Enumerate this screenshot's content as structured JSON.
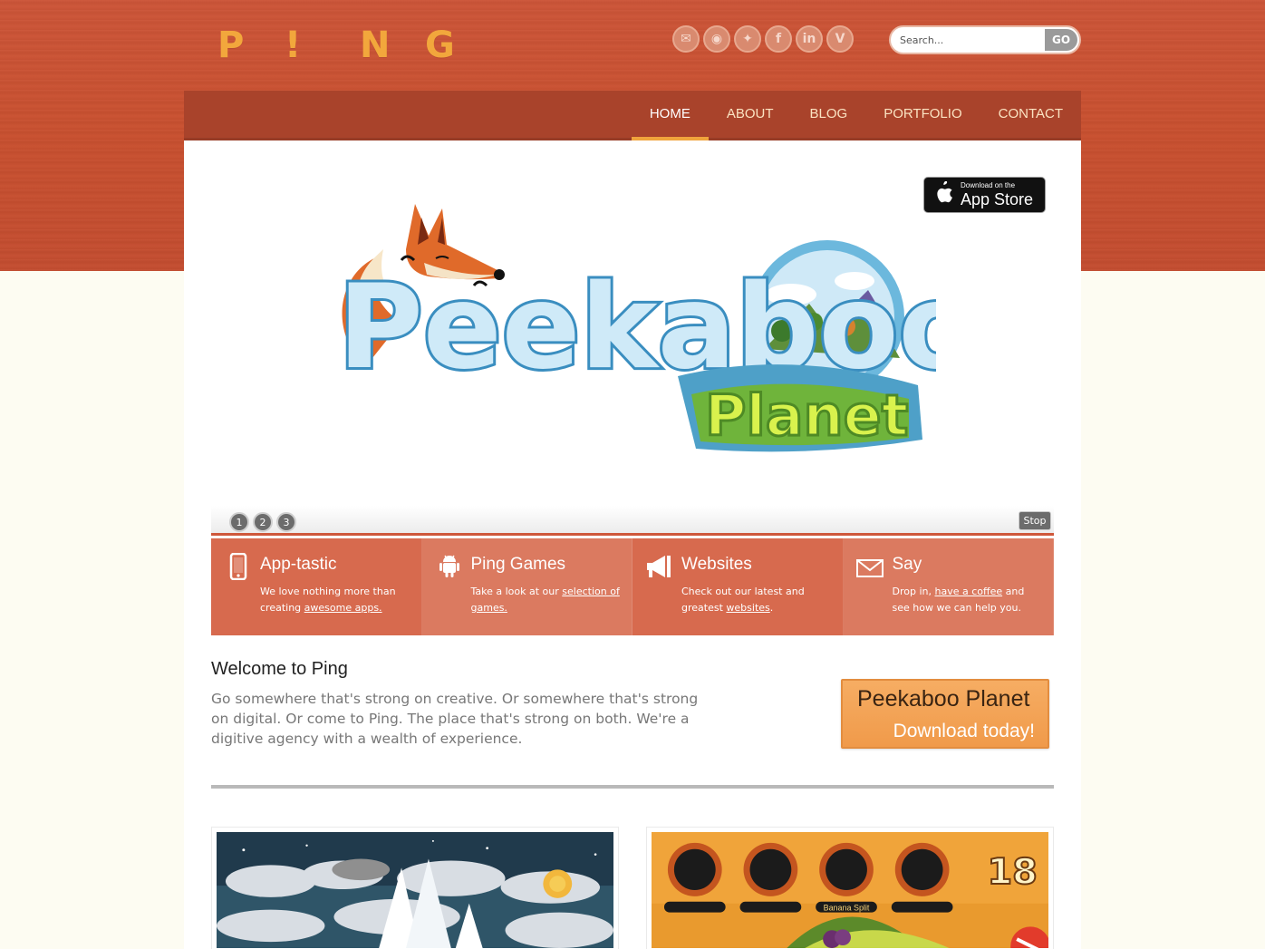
{
  "logo": {
    "letters": [
      "P",
      "!",
      "N",
      "G"
    ]
  },
  "social": [
    {
      "icon": "mail-icon",
      "glyph": "✉"
    },
    {
      "icon": "rss-icon",
      "glyph": "◉"
    },
    {
      "icon": "twitter-icon",
      "glyph": "✦"
    },
    {
      "icon": "facebook-icon",
      "glyph": "f"
    },
    {
      "icon": "linkedin-icon",
      "glyph": "in"
    },
    {
      "icon": "vimeo-icon",
      "glyph": "V"
    }
  ],
  "search": {
    "placeholder": "Search...",
    "button": "GO"
  },
  "nav": {
    "items": [
      {
        "label": "HOME",
        "active": true
      },
      {
        "label": "ABOUT"
      },
      {
        "label": "BLOG"
      },
      {
        "label": "PORTFOLIO"
      },
      {
        "label": "CONTACT"
      }
    ]
  },
  "appstore": {
    "small": "Download on the",
    "big": "App Store"
  },
  "hero": {
    "title_line1": "Peekaboo",
    "title_line2": "Planet"
  },
  "slider": {
    "dots": [
      "1",
      "2",
      "3"
    ],
    "stop": "Stop"
  },
  "features": [
    {
      "title": "App-tastic",
      "text_before": "We love nothing more than creating ",
      "link": "awesome apps.",
      "text_after": ""
    },
    {
      "title": "Ping Games",
      "text_before": "Take a look at our ",
      "link": "selection of games.",
      "text_after": ""
    },
    {
      "title": "Websites",
      "text_before": "Check out our latest and greatest ",
      "link": "websites",
      "text_after": "."
    },
    {
      "title": "Say",
      "text_before": "Drop in, ",
      "link": "have a coffee",
      "text_after": " and see how we can help you."
    }
  ],
  "welcome": {
    "heading": "Welcome to Ping",
    "body": "Go somewhere that's strong on creative. Or somewhere that's strong on digital. Or come to Ping. The place that's strong on both. We're a digitive agency with a wealth of experience."
  },
  "cta": {
    "line1": "Peekaboo Planet",
    "line2": "Download today!"
  },
  "thumbs": {
    "game_score": "18",
    "game_label": "Banana Split"
  },
  "colors": {
    "accent": "#cf583b",
    "nav_bg": "#a9432b",
    "logo": "#f2a73c",
    "cta": "#f09a4a"
  }
}
